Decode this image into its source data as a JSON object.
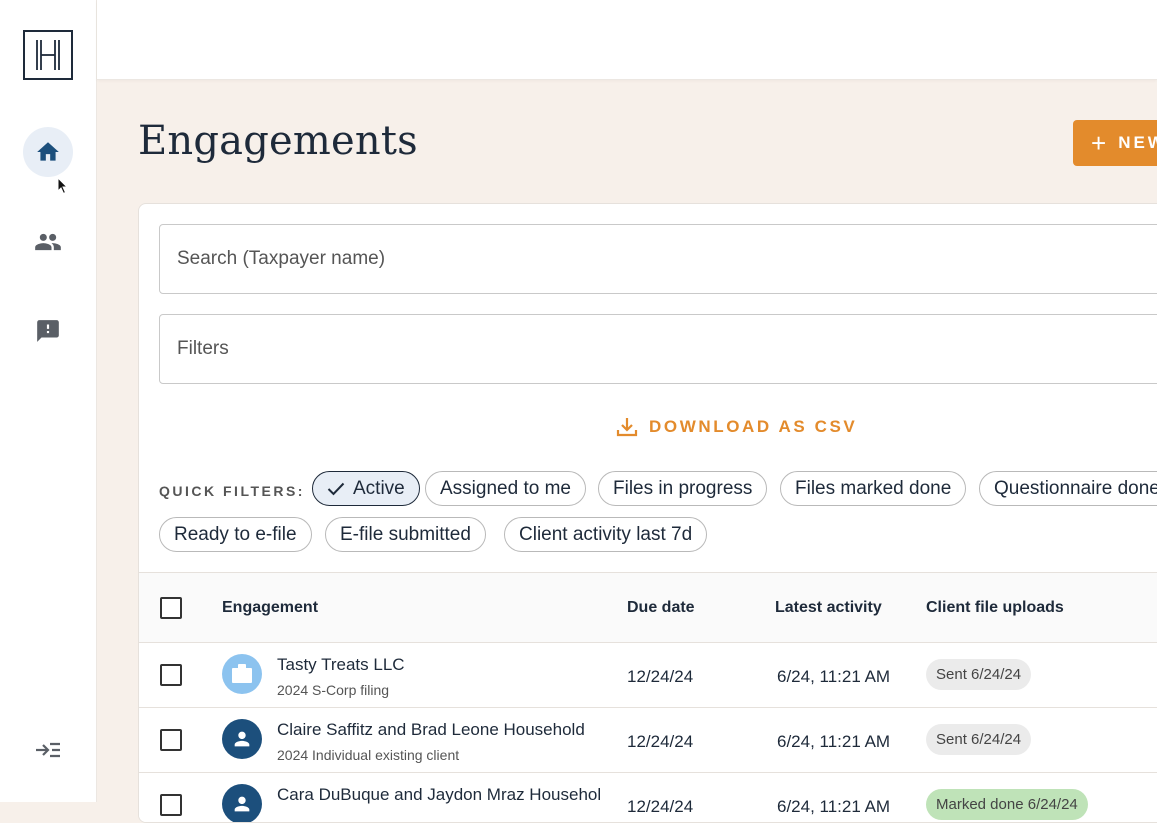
{
  "sidebar": {
    "logo": "H",
    "items": [
      {
        "name": "home",
        "icon": "home-icon",
        "active": true
      },
      {
        "name": "clients",
        "icon": "people-icon",
        "active": false
      },
      {
        "name": "feedback",
        "icon": "feedback-icon",
        "active": false
      }
    ],
    "collapse_icon": "collapse-sidebar-icon"
  },
  "header": {
    "title": "Engagements",
    "new_button_label": "NEW"
  },
  "search": {
    "placeholder": "Search (Taxpayer name)",
    "value": ""
  },
  "filters": {
    "placeholder": "Filters"
  },
  "download_csv_label": "DOWNLOAD AS CSV",
  "quick_filters": {
    "label": "QUICK FILTERS:",
    "chips": [
      {
        "label": "Active",
        "selected": true
      },
      {
        "label": "Assigned to me",
        "selected": false
      },
      {
        "label": "Files in progress",
        "selected": false
      },
      {
        "label": "Files marked done",
        "selected": false
      },
      {
        "label": "Questionnaire done",
        "selected": false
      },
      {
        "label": "Ready to e-file",
        "selected": false
      },
      {
        "label": "E-file submitted",
        "selected": false
      },
      {
        "label": "Client activity last 7d",
        "selected": false
      }
    ]
  },
  "table": {
    "columns": [
      "Engagement",
      "Due date",
      "Latest activity",
      "Client file uploads"
    ],
    "rows": [
      {
        "name": "Tasty Treats LLC",
        "sub": "2024 S-Corp filing",
        "type": "business",
        "due": "12/24/24",
        "activity": "6/24, 11:21 AM",
        "uploads": "Sent 6/24/24",
        "uploads_status": "sent"
      },
      {
        "name": "Claire Saffitz and Brad Leone Household",
        "sub": "2024 Individual existing client",
        "type": "individual",
        "due": "12/24/24",
        "activity": "6/24, 11:21 AM",
        "uploads": "Sent 6/24/24",
        "uploads_status": "sent"
      },
      {
        "name": "Cara DuBuque and Jaydon Mraz Househol",
        "sub": "",
        "type": "individual",
        "due": "12/24/24",
        "activity": "6/24, 11:21 AM",
        "uploads": "Marked done 6/24/24",
        "uploads_status": "done"
      }
    ]
  },
  "colors": {
    "accent": "#e38b2c",
    "navy": "#1e2a3a",
    "page_bg": "#f7f0ea",
    "business_avatar": "#8cc3ef",
    "individual_avatar": "#1c4f7c",
    "done_badge": "#bfe3b8"
  }
}
